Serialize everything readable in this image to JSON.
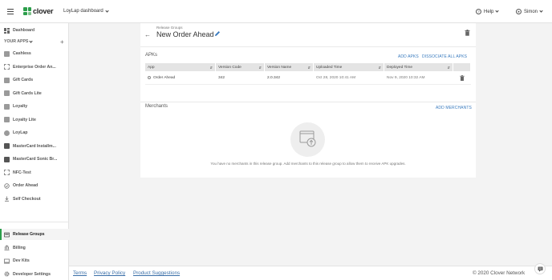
{
  "topbar": {
    "logo_text": "clover",
    "merchant": "LoyLap dashboard",
    "help_label": "Help",
    "user_label": "Simon"
  },
  "sidebar": {
    "dashboard": "Dashboard",
    "your_apps_label": "YOUR APPS",
    "apps": [
      {
        "label": "Cashless",
        "icon": "cashless-icon"
      },
      {
        "label": "Enterprise Order An...",
        "icon": "placeholder-app-icon"
      },
      {
        "label": "Gift Cards",
        "icon": "gift-card-icon"
      },
      {
        "label": "Gift Cards Lite",
        "icon": "gift-card-icon"
      },
      {
        "label": "Loyalty",
        "icon": "loyalty-icon"
      },
      {
        "label": "Loyalty Lite",
        "icon": "loyalty-icon"
      },
      {
        "label": "LoyLap",
        "icon": "loylap-icon"
      },
      {
        "label": "MasterCard Installm...",
        "icon": "mastercard-icon"
      },
      {
        "label": "MasterCard Sonic Br...",
        "icon": "mastercard-icon"
      },
      {
        "label": "NFC-Test",
        "icon": "placeholder-app-icon"
      },
      {
        "label": "Order Ahead",
        "icon": "order-ahead-icon"
      },
      {
        "label": "Self Checkout",
        "icon": "self-checkout-icon"
      }
    ],
    "bottom": [
      {
        "label": "Release Groups",
        "icon": "release-groups-icon",
        "active": true
      },
      {
        "label": "Billing",
        "icon": "billing-icon"
      },
      {
        "label": "Dev Kits",
        "icon": "dev-kits-icon"
      },
      {
        "label": "Developer Settings",
        "icon": "gear-icon"
      }
    ]
  },
  "main": {
    "breadcrumb": "Release Groups",
    "title": "New Order Ahead",
    "apks": {
      "heading": "APKs",
      "add_label": "ADD APKS",
      "dissociate_label": "DISSOCIATE ALL APKS",
      "columns": [
        "App",
        "Version Code",
        "Version Name",
        "Uploaded Time",
        "Deployed Time"
      ],
      "rows": [
        {
          "app": "Order Ahead",
          "version_code": "342",
          "version_name": "2.0.342",
          "uploaded": "Oct 28, 2020 10:41 AM",
          "deployed": "Nov 9, 2020 10:32 AM"
        }
      ]
    },
    "merchants": {
      "heading": "Merchants",
      "add_label": "ADD MERCHANTS",
      "empty_message": "You have no merchants in this release group. Add merchants to this release group to allow them to receive APK upgrades."
    }
  },
  "footer": {
    "terms": "Terms",
    "privacy": "Privacy Policy",
    "suggestions": "Product Suggestions",
    "copyright": "© 2020 Clover Network"
  },
  "colors": {
    "brand_green": "#2c9e4b",
    "link_blue": "#3a7bbf"
  }
}
